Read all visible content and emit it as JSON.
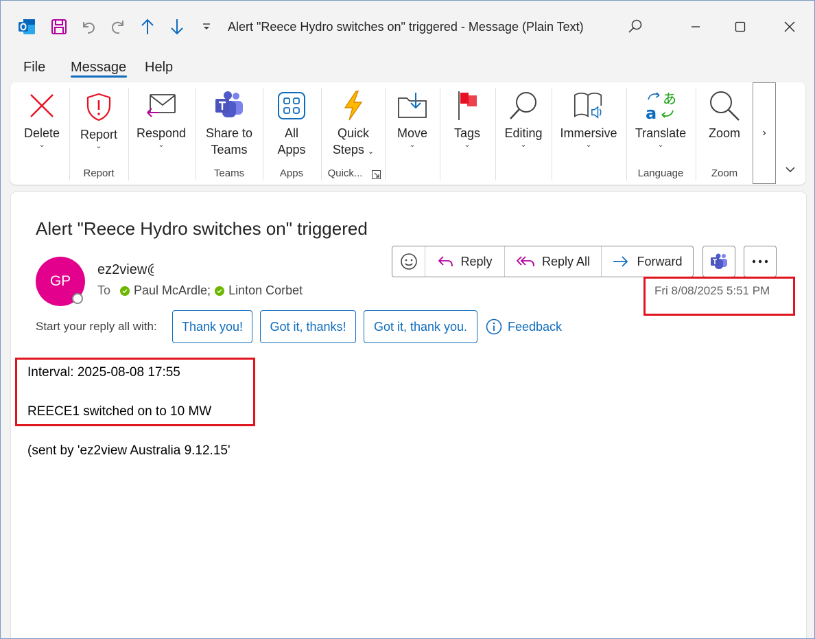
{
  "window": {
    "title": "Alert \"Reece Hydro switches on\" triggered  -  Message (Plain Text)"
  },
  "menu": {
    "tabs": [
      {
        "label": "File"
      },
      {
        "label": "Message"
      },
      {
        "label": "Help"
      }
    ],
    "active_tab": "Message"
  },
  "ribbon": {
    "delete": "Delete",
    "report": "Report",
    "respond": "Respond",
    "share_line1": "Share to",
    "share_line2": "Teams",
    "allapps_line1": "All",
    "allapps_line2": "Apps",
    "quick_line1": "Quick",
    "quick_line2": "Steps",
    "move": "Move",
    "tags": "Tags",
    "editing": "Editing",
    "immersive": "Immersive",
    "translate": "Translate",
    "zoom": "Zoom",
    "groups": {
      "report": "Report",
      "teams": "Teams",
      "apps": "Apps",
      "quick": "Quick...",
      "language": "Language",
      "zoom": "Zoom"
    }
  },
  "message": {
    "subject": "Alert \"Reece Hydro switches on\" triggered",
    "avatar_initials": "GP",
    "sender": "ez2view@",
    "to_label": "To",
    "recipients": [
      "Paul McArdle;",
      "Linton Corbet"
    ],
    "date": "Fri 8/08/2025 5:51 PM",
    "actions": {
      "reply": "Reply",
      "reply_all": "Reply All",
      "forward": "Forward"
    },
    "reply_prompt": "Start your reply all with:",
    "quick_replies": [
      "Thank you!",
      "Got it, thanks!",
      "Got it, thank you."
    ],
    "feedback": "Feedback",
    "body": {
      "interval": "Interval: 2025-08-08 17:55",
      "switched": "REECE1 switched on to 10 MW",
      "sent_by": "(sent by 'ez2view Australia 9.12.15'"
    }
  },
  "colors": {
    "accent": "#0f6cbd",
    "avatar": "#e3008c",
    "highlight": "#e0141e"
  }
}
